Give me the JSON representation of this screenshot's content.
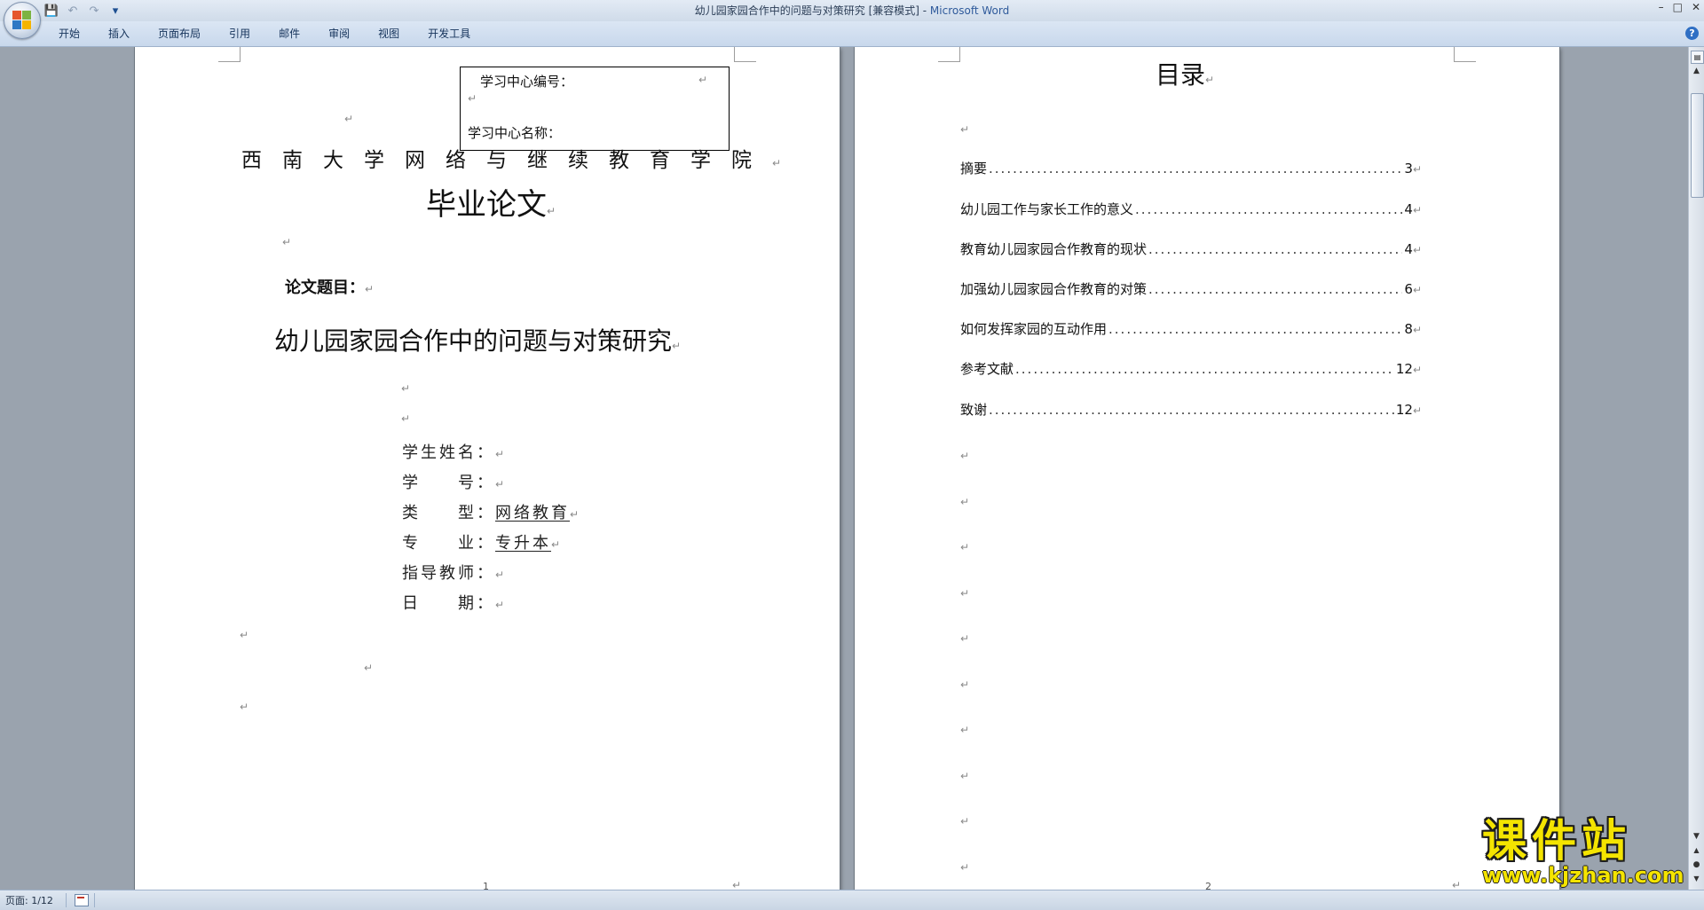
{
  "window": {
    "title": "幼儿园家园合作中的问题与对策研究 [兼容模式] - ",
    "app_name": "Microsoft Word",
    "controls": [
      "–",
      "□",
      "✕"
    ]
  },
  "quick_access": {
    "icons": [
      "save-icon",
      "undo-icon",
      "redo-icon",
      "customize-icon"
    ],
    "glyphs": [
      "💾",
      "↶",
      "↷",
      "▾"
    ]
  },
  "ribbon": {
    "tabs": [
      "开始",
      "插入",
      "页面布局",
      "引用",
      "邮件",
      "审阅",
      "视图",
      "开发工具"
    ],
    "help": "?"
  },
  "page1": {
    "info_box": {
      "center_no_label": "学习中心编号：",
      "center_name_label": "学习中心名称："
    },
    "college": "西南大学网络与继续教育学院",
    "doc_type": "毕业论文",
    "topic_label": "论文题目：",
    "topic": "幼儿园家园合作中的问题与对策研究",
    "fields": {
      "student_name": "学生姓名：",
      "student_id": "学　　号：",
      "type_label": "类　　型：",
      "type_value": "网络教育",
      "major_label": "专　　业：",
      "major_value": "专升本",
      "advisor": "指导教师：",
      "date": "日　　期："
    },
    "page_number": "1"
  },
  "page2": {
    "heading": "目录",
    "toc": [
      {
        "title": "摘要 ",
        "page": "3"
      },
      {
        "title": "幼儿园工作与家长工作的意义",
        "page": "4"
      },
      {
        "title": "教育幼儿园家园合作教育的现状",
        "page": "4"
      },
      {
        "title": "加强幼儿园家园合作教育的对策",
        "page": "6"
      },
      {
        "title": "如何发挥家园的互动作用",
        "page": "8"
      },
      {
        "title": "参考文献",
        "page": "12"
      },
      {
        "title": "致谢",
        "page": "12"
      }
    ],
    "page_number": "2"
  },
  "paragraph_mark": "↵",
  "status_bar": {
    "page_indicator": "页面: 1/12"
  },
  "watermark": {
    "text": "课件站",
    "url": "www.kjzhan.com"
  },
  "colors": {
    "window_bg": "#9aa3ae",
    "ribbon_bg": "#dbe6f4",
    "watermark_fill": "#f4e400",
    "app_name_color": "#2f5a9b"
  }
}
